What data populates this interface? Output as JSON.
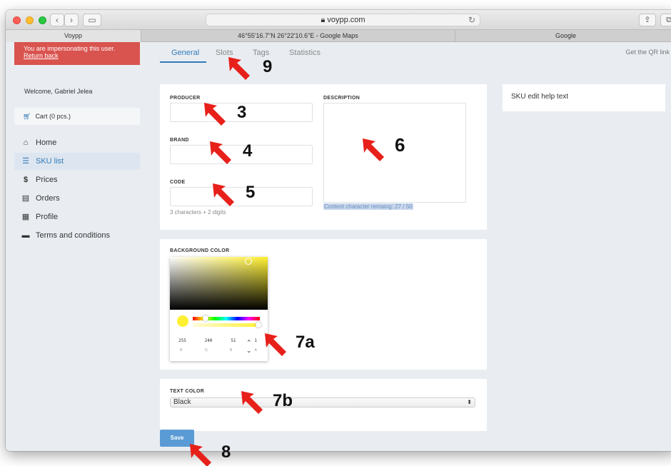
{
  "browser": {
    "address": "voypp.com",
    "tabs": [
      "Voypp",
      "46°55'16.7\"N 26°22'10.6\"E - Google Maps",
      "Google"
    ]
  },
  "sidebar": {
    "impersonation_text": "You are impersonating this user.",
    "return_link": "Return back",
    "welcome": "Welcome, Gabriel Jelea",
    "cart_label": "Cart (0 pcs.)",
    "items": [
      {
        "label": "Home",
        "icon": "home-icon",
        "glyph": "⌂"
      },
      {
        "label": "SKU list",
        "icon": "list-icon",
        "glyph": "☰"
      },
      {
        "label": "Prices",
        "icon": "dollar-icon",
        "glyph": "$"
      },
      {
        "label": "Orders",
        "icon": "file-icon",
        "glyph": "▤"
      },
      {
        "label": "Profile",
        "icon": "id-card-icon",
        "glyph": "▦"
      },
      {
        "label": "Terms and conditions",
        "icon": "book-icon",
        "glyph": "▬"
      }
    ],
    "active_item": "SKU list"
  },
  "main_tabs": {
    "tabs": [
      "General",
      "Slots",
      "Tags",
      "Statistics"
    ],
    "active": "General",
    "qr_link": "Get the QR link"
  },
  "form": {
    "producer_label": "PRODUCER",
    "producer_value": "",
    "brand_label": "BRAND",
    "brand_value": "",
    "code_label": "CODE",
    "code_value": "",
    "code_hint": "3 characters + 2 digits",
    "description_label": "DESCRIPTION",
    "description_value": "",
    "description_counter": "Content character remaing: 27 / 50",
    "bg_color_label": "BACKGROUND COLOR",
    "color": {
      "r": "255",
      "g": "240",
      "b": "51",
      "a": "1",
      "hex": "#fff033"
    },
    "color_labels": [
      "R",
      "G",
      "B",
      "A"
    ],
    "text_color_label": "TEXT COLOR",
    "text_color_value": "Black",
    "save_label": "Save"
  },
  "help": {
    "text": "SKU edit help text"
  },
  "annotations": [
    "9",
    "3",
    "4",
    "5",
    "6",
    "7a",
    "7b",
    "8"
  ],
  "colors": {
    "accent": "#337ab7",
    "danger": "#d9534f",
    "save": "#5b9bd5"
  }
}
